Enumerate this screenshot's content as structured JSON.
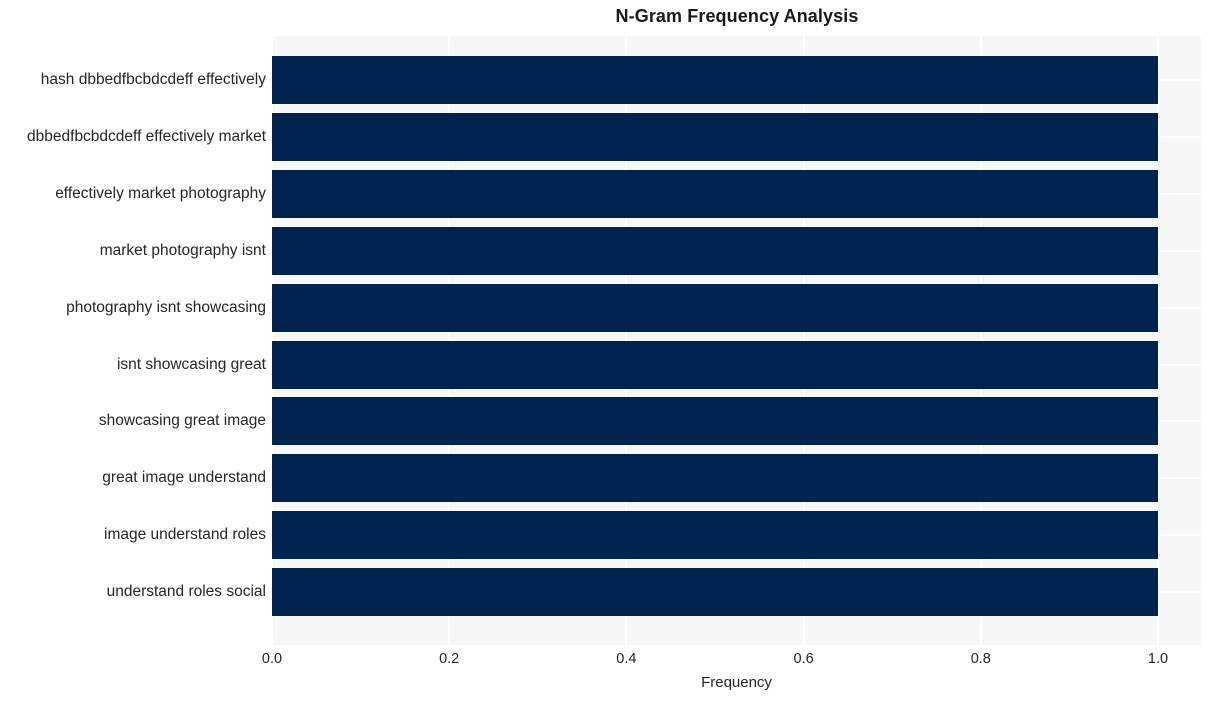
{
  "chart_data": {
    "type": "bar",
    "orientation": "horizontal",
    "title": "N-Gram Frequency Analysis",
    "xlabel": "Frequency",
    "ylabel": "",
    "xlim": [
      0.0,
      1.0
    ],
    "xticks": [
      "0.0",
      "0.2",
      "0.4",
      "0.6",
      "0.8",
      "1.0"
    ],
    "xtick_values": [
      0.0,
      0.2,
      0.4,
      0.6,
      0.8,
      1.0
    ],
    "grid": true,
    "legend": "none",
    "bar_color": "#002350",
    "plot_background": "#f7f7f8",
    "gridline_color": "#ffffff",
    "categories": [
      "hash dbbedfbcbdcdeff effectively",
      "dbbedfbcbdcdeff effectively market",
      "effectively market photography",
      "market photography isnt",
      "photography isnt showcasing",
      "isnt showcasing great",
      "showcasing great image",
      "great image understand",
      "image understand roles",
      "understand roles social"
    ],
    "values": [
      1.0,
      1.0,
      1.0,
      1.0,
      1.0,
      1.0,
      1.0,
      1.0,
      1.0,
      1.0
    ]
  }
}
